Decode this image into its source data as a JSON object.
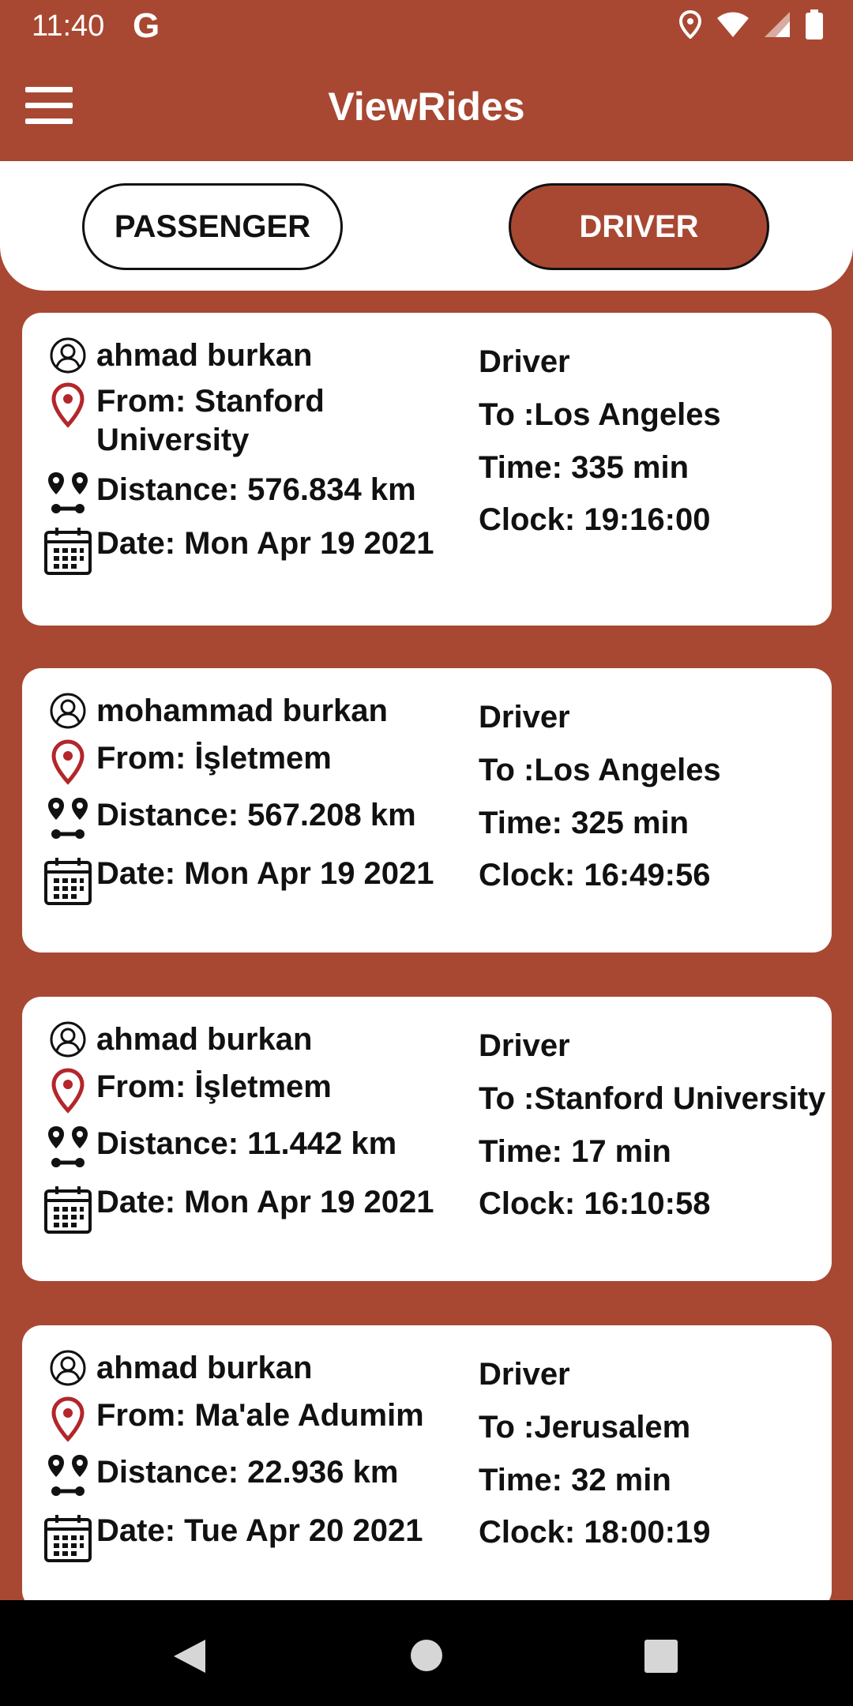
{
  "status": {
    "time": "11:40",
    "g_label": "G"
  },
  "app": {
    "title": "ViewRides"
  },
  "tabs": {
    "passenger": "PASSENGER",
    "driver": "DRIVER"
  },
  "colors": {
    "accent": "#A84832",
    "pin": "#B3262B"
  },
  "rides": [
    {
      "name": "ahmad burkan",
      "from": "From: Stanford University",
      "distance": "Distance: 576.834 km",
      "date": "Date: Mon Apr 19 2021",
      "role": "Driver",
      "to": "To :Los Angeles",
      "time": "Time: 335 min",
      "clock": "Clock: 19:16:00"
    },
    {
      "name": "mohammad burkan",
      "from": "From: İşletmem",
      "distance": "Distance: 567.208 km",
      "date": "Date: Mon Apr 19 2021",
      "role": "Driver",
      "to": "To :Los Angeles",
      "time": "Time: 325 min",
      "clock": "Clock: 16:49:56"
    },
    {
      "name": "ahmad burkan",
      "from": "From: İşletmem",
      "distance": "Distance: 11.442 km",
      "date": "Date: Mon Apr 19 2021",
      "role": "Driver",
      "to": "To :Stanford University",
      "time": "Time: 17 min",
      "clock": "Clock: 16:10:58"
    },
    {
      "name": "ahmad burkan",
      "from": "From: Ma'ale Adumim",
      "distance": "Distance: 22.936 km",
      "date": "Date: Tue Apr 20 2021",
      "role": "Driver",
      "to": "To :Jerusalem",
      "time": "Time: 32 min",
      "clock": "Clock: 18:00:19"
    }
  ]
}
